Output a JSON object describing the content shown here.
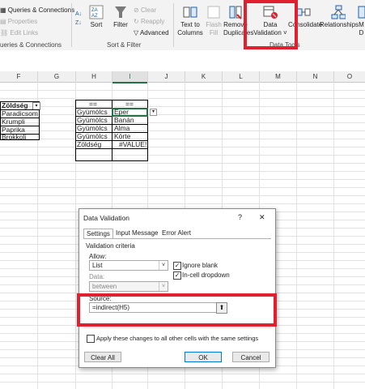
{
  "ribbon": {
    "queries_connections": "Queries & Connections",
    "properties": "Properties",
    "edit_links": "Edit Links",
    "queries_group": "ueries & Connections",
    "sort": "Sort",
    "filter": "Filter",
    "clear": "Clear",
    "reapply": "Reapply",
    "advanced": "Advanced",
    "sort_filter_group": "Sort & Filter",
    "text_to_columns": [
      "Text to",
      "Columns"
    ],
    "flash_fill": [
      "Flash",
      "Fill"
    ],
    "remove_duplicates": [
      "Remove",
      "Duplicates"
    ],
    "data_validation": [
      "Data",
      "Validation ˅"
    ],
    "consolidate": "Consolidate",
    "relationships": "Relationships",
    "manage_data_model": [
      "M",
      "D"
    ],
    "data_tools_group": "Data Tools"
  },
  "grid": {
    "columns": [
      "F",
      "G",
      "H",
      "I",
      "J",
      "K",
      "L",
      "M",
      "N",
      "O"
    ],
    "f_header": "Zöldség",
    "f_values": [
      "Paradicsom",
      "Krumpli",
      "Paprika",
      "Brokkoli"
    ],
    "h_header": "==",
    "i_header": "==",
    "h_values": [
      "Gyümölcs",
      "Gyümölcs",
      "Gyümölcs",
      "Gyümölcs",
      "Zöldség"
    ],
    "i_values": [
      "Eper",
      "Banán",
      "Alma",
      "Körte",
      "#VALUE!"
    ]
  },
  "dialog": {
    "title": "Data Validation",
    "help": "?",
    "close": "✕",
    "tabs": [
      "Settings",
      "Input Message",
      "Error Alert"
    ],
    "criteria_label": "Validation criteria",
    "allow_label": "Allow:",
    "allow_value": "List",
    "ignore_blank": "Ignore blank",
    "in_cell_dropdown": "In-cell dropdown",
    "data_label": "Data:",
    "data_value": "between",
    "source_label": "Source:",
    "source_value": "=indirect(H5)",
    "apply_all": "Apply these changes to all other cells with the same settings",
    "clear_all": "Clear All",
    "ok": "OK",
    "cancel": "Cancel"
  },
  "colors": {
    "highlight": "#e0202e",
    "excel_green": "#217346"
  }
}
